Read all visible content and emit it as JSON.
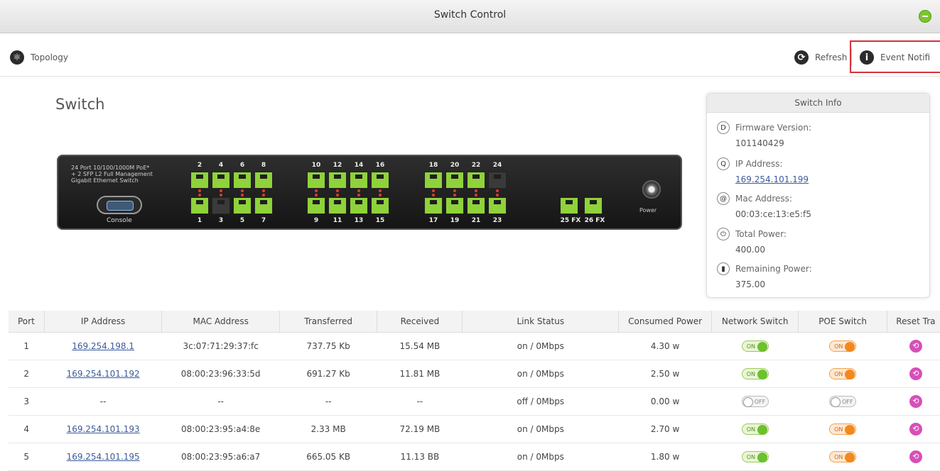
{
  "window": {
    "title": "Switch Control",
    "status_icon": "status-dot-icon"
  },
  "toolbar": {
    "topology_label": "Topology",
    "refresh_label": "Refresh",
    "events_label": "Event Notifi"
  },
  "switch": {
    "heading": "Switch",
    "caption_line1": "24 Port 10/100/1000M PoE*",
    "caption_line2": "+ 2 SFP L2 Full Management",
    "caption_line3": "Gigabit Ethernet Switch",
    "console_label": "Console",
    "power_label": "Power",
    "top_ports": [
      "2",
      "4",
      "6",
      "8",
      "10",
      "12",
      "14",
      "16",
      "18",
      "20",
      "22",
      "24"
    ],
    "bottom_ports": [
      "1",
      "3",
      "5",
      "7",
      "9",
      "11",
      "13",
      "15",
      "17",
      "19",
      "21",
      "23"
    ],
    "top_status": [
      "up",
      "up",
      "up",
      "up",
      "up",
      "up",
      "up",
      "up",
      "up",
      "up",
      "up",
      "down"
    ],
    "bottom_status": [
      "up",
      "down",
      "up",
      "up",
      "up",
      "up",
      "up",
      "up",
      "up",
      "up",
      "up",
      "up"
    ],
    "fx_labels": [
      "25 FX",
      "26 FX"
    ]
  },
  "switch_info": {
    "title": "Switch Info",
    "firmware_label": "Firmware Version:",
    "firmware_value": "101140429",
    "ip_label": "IP Address:",
    "ip_value": "169.254.101.199",
    "mac_label": "Mac Address:",
    "mac_value": "00:03:ce:13:e5:f5",
    "total_power_label": "Total Power:",
    "total_power_value": "400.00",
    "remaining_power_label": "Remaining Power:",
    "remaining_power_value": "375.00"
  },
  "table": {
    "headers": [
      "Port",
      "IP Address",
      "MAC Address",
      "Transferred",
      "Received",
      "Link Status",
      "Consumed Power",
      "Network Switch",
      "POE Switch",
      "Reset Tra"
    ],
    "rows": [
      {
        "port": "1",
        "ip": "169.254.198.1",
        "mac": "3c:07:71:29:37:fc",
        "transferred": "737.75 Kb",
        "received": "15.54 MB",
        "link": "on / 0Mbps",
        "power": "4.30 w",
        "net": "ON",
        "poe": "ON"
      },
      {
        "port": "2",
        "ip": "169.254.101.192",
        "mac": "08:00:23:96:33:5d",
        "transferred": "691.27 Kb",
        "received": "11.81 MB",
        "link": "on / 0Mbps",
        "power": "2.50 w",
        "net": "ON",
        "poe": "ON"
      },
      {
        "port": "3",
        "ip": "--",
        "mac": "--",
        "transferred": "--",
        "received": "--",
        "link": "off / 0Mbps",
        "power": "0.00 w",
        "net": "OFF",
        "poe": "OFF"
      },
      {
        "port": "4",
        "ip": "169.254.101.193",
        "mac": "08:00:23:95:a4:8e",
        "transferred": "2.33 MB",
        "received": "72.19 MB",
        "link": "on / 0Mbps",
        "power": "2.70 w",
        "net": "ON",
        "poe": "ON"
      },
      {
        "port": "5",
        "ip": "169.254.101.195",
        "mac": "08:00:23:95:a6:a7",
        "transferred": "665.05 KB",
        "received": "11.13 BB",
        "link": "on / 0Mbps",
        "power": "1.80 w",
        "net": "ON",
        "poe": "ON"
      }
    ]
  }
}
